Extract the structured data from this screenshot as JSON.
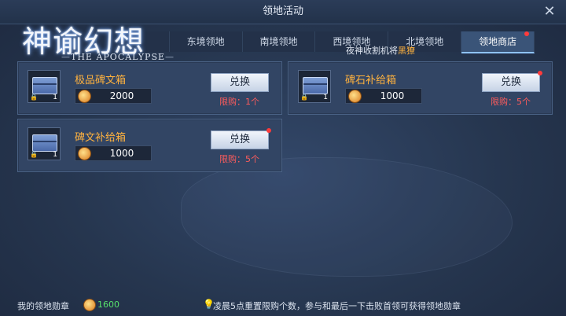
{
  "window": {
    "title": "领地活动"
  },
  "logo": {
    "main": "神谕幻想",
    "sub": "THE APOCALYPSE"
  },
  "tabs": [
    {
      "label": ""
    },
    {
      "label": ""
    },
    {
      "label": "东境领地"
    },
    {
      "label": "南境领地"
    },
    {
      "label": "西境领地"
    },
    {
      "label": "北境领地"
    },
    {
      "label": "领地商店",
      "active": true
    }
  ],
  "marquee": {
    "prefix": "夜神收割机将",
    "highlight": "黑獠"
  },
  "shop_items": [
    {
      "name": "极品碑文箱",
      "price": "2000",
      "quantity": "1",
      "button": "兑换",
      "limit": "限购：1个"
    },
    {
      "name": "碑石补给箱",
      "price": "1000",
      "quantity": "1",
      "button": "兑换",
      "limit": "限购：5个"
    },
    {
      "name": "碑文补给箱",
      "price": "1000",
      "quantity": "1",
      "button": "兑换",
      "limit": "限购：5个"
    }
  ],
  "footer": {
    "badge_label": "我的领地勋章",
    "badge_amount": "1600",
    "tip": "凌晨5点重置限购个数，参与和最后一下击败首领可获得领地勋章"
  },
  "colors": {
    "accent": "#ffb23e",
    "limit_red": "#ff5c5c",
    "amount_green": "#56e06b"
  }
}
